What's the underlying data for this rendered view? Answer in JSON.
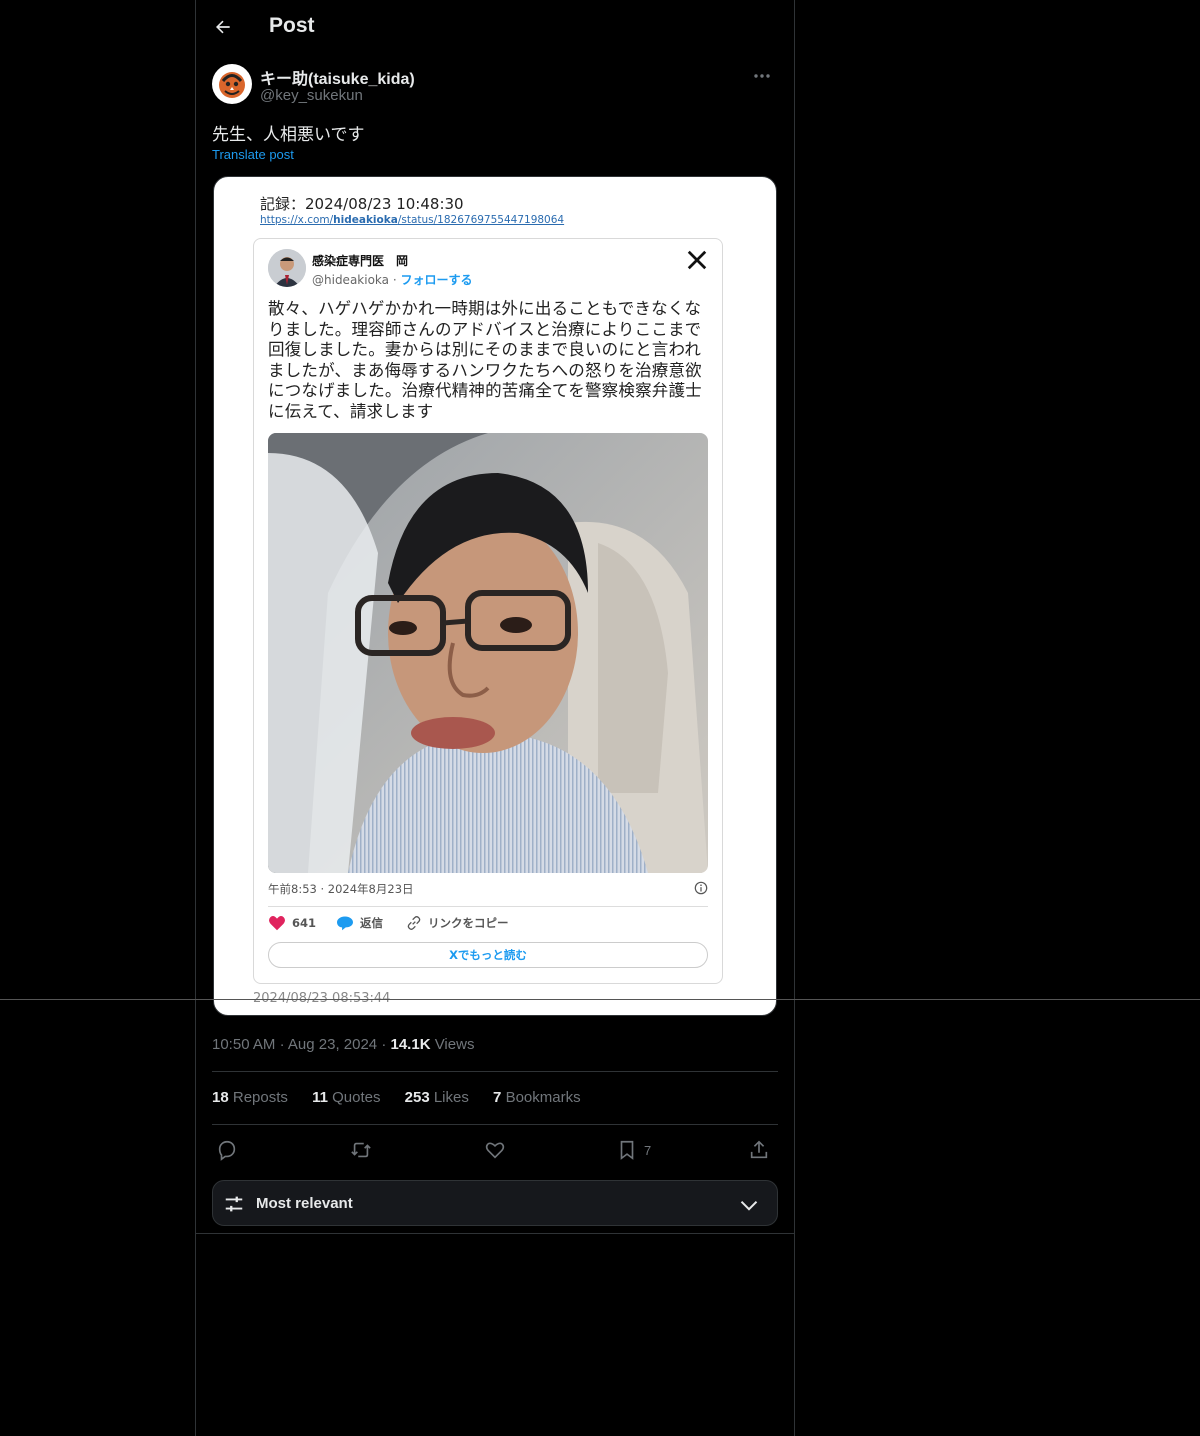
{
  "header": {
    "title": "Post"
  },
  "post": {
    "author_name": "キー助(taisuke_kida)",
    "author_handle": "@key_sukekun",
    "text": "先生、人相悪いです",
    "translate_label": "Translate post",
    "time": "10:50 AM",
    "date": "Aug 23, 2024",
    "views_count": "14.1K",
    "views_label": "Views"
  },
  "media": {
    "record_time": "記録：2024/08/23 10:48:30",
    "record_url_prefix": "https://x.com/",
    "record_url_user": "hideakioka",
    "record_url_suffix": "/status/1826769755447198064",
    "record_end": "2024/08/23 08:53:44",
    "embed": {
      "name": "感染症専門医　岡",
      "handle": "@hideakioka",
      "sep": " · ",
      "follow": "フォローする",
      "text": "散々、ハゲハゲかかれ一時期は外に出ることもできなくなりました。理容師さんのアドバイスと治療によりここまで回復しました。妻からは別にそのままで良いのにと言われましたが、まあ侮辱するハンワクたちへの怒りを治療意欲につなげました。治療代精神的苦痛全てを警察検察弁護士に伝えて、請求します",
      "timestamp": "午前8:53 · 2024年8月23日",
      "likes": "641",
      "reply": "返信",
      "copy_link": "リンクをコピー",
      "read_more": "Xでもっと読む"
    }
  },
  "stats": {
    "reposts_count": "18",
    "reposts_label": "Reposts",
    "quotes_count": "11",
    "quotes_label": "Quotes",
    "likes_count": "253",
    "likes_label": "Likes",
    "bookmarks_count": "7",
    "bookmarks_label": "Bookmarks"
  },
  "actions": {
    "bookmark_count": "7"
  },
  "sort": {
    "label": "Most relevant"
  },
  "icons": {
    "back": "arrow-left-icon",
    "more": "more-horizontal-icon",
    "reply": "reply-icon",
    "repost": "repost-icon",
    "like": "heart-icon",
    "bookmark": "bookmark-icon",
    "share": "share-icon",
    "sort": "sliders-icon",
    "chevron": "chevron-down-icon"
  },
  "colors": {
    "accent": "#1d9bf0",
    "background": "#000000",
    "text": "#e7e9ea",
    "muted": "#71767b",
    "border": "#2f3336"
  }
}
